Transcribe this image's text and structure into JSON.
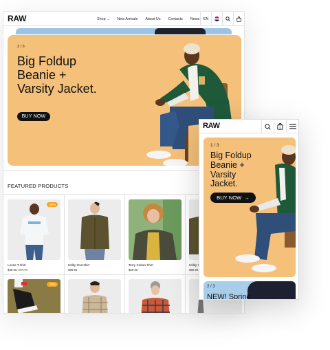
{
  "desktop": {
    "logo": "RAW",
    "nav": {
      "links": [
        "Shop",
        "New Arrivals",
        "About Us",
        "Contacts",
        "News"
      ],
      "shop_chevron": "⌄",
      "language": "EN"
    },
    "hero": {
      "counter": "2 / 3",
      "title_lines": [
        "Big Foldup",
        "Beanie +",
        "Varsity Jacket."
      ],
      "cta": "BUY NOW"
    },
    "featured_heading": "FEATURED PRODUCTS",
    "products": [
      {
        "name": "Loose T-shirt",
        "price": "$39.95",
        "old_price": "$59.95",
        "badge": "-20%"
      },
      {
        "name": "Utility Overshirt",
        "price": "$89.95",
        "old_price": "",
        "badge": ""
      },
      {
        "name": "Terry Cuban Shirt",
        "price": "$69.95",
        "old_price": "",
        "badge": ""
      },
      {
        "name": "Utility O",
        "price": "$89.95",
        "old_price": "",
        "badge": ""
      }
    ],
    "products_row2": [
      {
        "badge": "-20%"
      },
      {
        "badge": ""
      },
      {
        "badge": ""
      },
      {
        "badge": ""
      }
    ]
  },
  "mobile": {
    "logo": "RAW",
    "hero": {
      "counter": "1 / 3",
      "title_lines": [
        "Big Foldup",
        "Beanie +",
        "Varsity",
        "Jacket."
      ],
      "cta": "BUY NOW",
      "cta_arrow": "→"
    },
    "next_slide": {
      "counter": "2 / 3",
      "title": "NEW! Spring"
    }
  },
  "colors": {
    "hero_bg": "#f4c07a",
    "badge": "#f5a623",
    "strip_blue": "#9cc3e5",
    "button": "#111111"
  },
  "icons": [
    "chevron-down-icon",
    "flag-icon",
    "search-icon",
    "bag-icon",
    "menu-icon",
    "arrow-right-icon"
  ]
}
